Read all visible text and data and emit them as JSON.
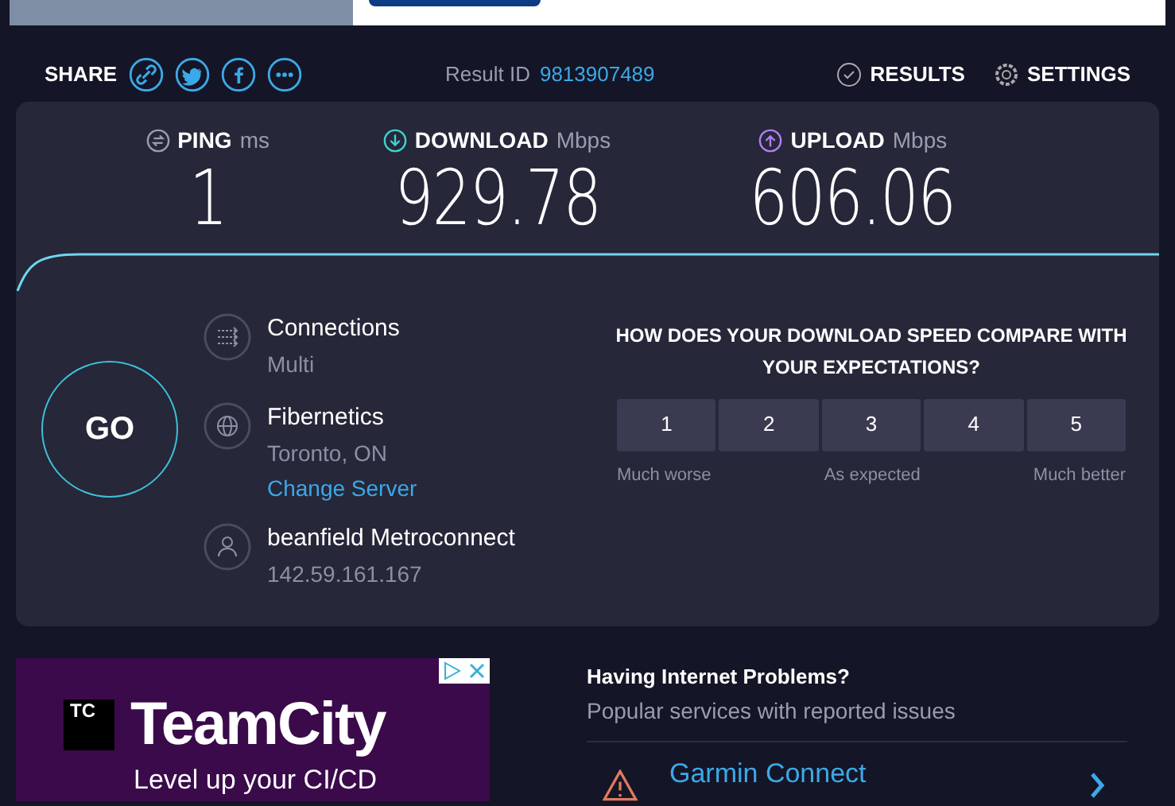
{
  "header": {
    "share_label": "SHARE",
    "share_links": [
      {
        "kind": "link"
      },
      {
        "kind": "twitter"
      },
      {
        "kind": "facebook"
      },
      {
        "kind": "more"
      }
    ],
    "result_label": "Result ID",
    "result_id": "9813907489",
    "nav": [
      {
        "kind": "results",
        "label": "RESULTS"
      },
      {
        "kind": "settings",
        "label": "SETTINGS"
      }
    ]
  },
  "metrics": [
    {
      "kind": "ping",
      "label": "PING",
      "unit": "ms",
      "value": "1"
    },
    {
      "kind": "download",
      "label": "DOWNLOAD",
      "unit": "Mbps",
      "value": "929.78"
    },
    {
      "kind": "upload",
      "label": "UPLOAD",
      "unit": "Mbps",
      "value": "606.06"
    }
  ],
  "go_button": "GO",
  "info": [
    {
      "kind": "connections",
      "title": "Connections",
      "subtitle": "Multi"
    },
    {
      "kind": "server",
      "title": "Fibernetics",
      "subtitle": "Toronto, ON",
      "link": "Change Server"
    },
    {
      "kind": "provider",
      "title": "beanfield Metroconnect",
      "subtitle": "142.59.161.167"
    }
  ],
  "survey": {
    "question": "HOW DOES YOUR DOWNLOAD SPEED COMPARE WITH YOUR EXPECTATIONS?",
    "options": [
      {
        "label": "1",
        "selected": false
      },
      {
        "label": "2",
        "selected": false
      },
      {
        "label": "3",
        "selected": false
      },
      {
        "label": "4",
        "selected": false
      },
      {
        "label": "5",
        "selected": false
      }
    ],
    "scale_labels": [
      "Much worse",
      "As expected",
      "Much better"
    ]
  },
  "ad": {
    "logo_mark": "TC",
    "brand": "TeamCity",
    "tagline": "Level up your CI/CD"
  },
  "problems": {
    "title": "Having Internet Problems?",
    "subtitle": "Popular services with reported issues",
    "services": [
      {
        "name": "Garmin Connect"
      }
    ]
  }
}
